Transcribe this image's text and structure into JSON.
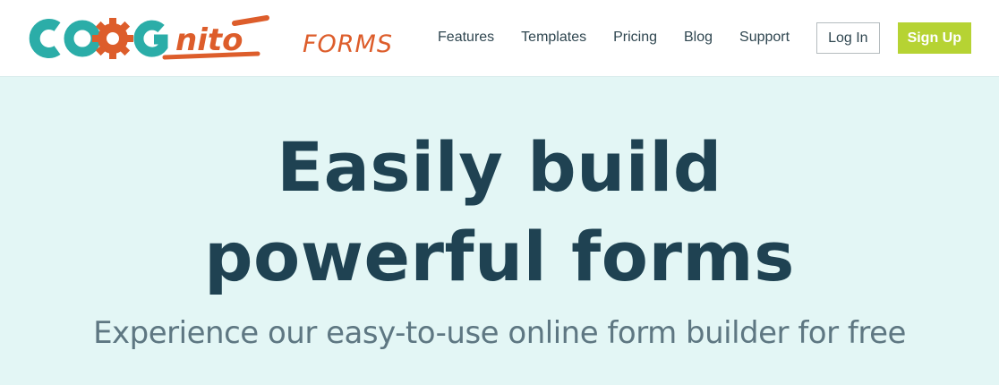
{
  "brand": {
    "logo_text": "COGNITO",
    "wordmark": "FORMS",
    "colors": {
      "teal": "#2bada8",
      "orange": "#dd5d2b"
    }
  },
  "nav": {
    "items": [
      {
        "label": "Features"
      },
      {
        "label": "Templates"
      },
      {
        "label": "Pricing"
      },
      {
        "label": "Blog"
      },
      {
        "label": "Support"
      }
    ],
    "login_label": "Log In",
    "signup_label": "Sign Up"
  },
  "hero": {
    "title_line1": "Easily build",
    "title_line2": "powerful forms",
    "subtitle": "Experience our easy-to-use online form builder for free"
  },
  "colors": {
    "hero_background": "#e3f6f5",
    "title": "#1f4252",
    "signup_button": "#b6d333"
  }
}
